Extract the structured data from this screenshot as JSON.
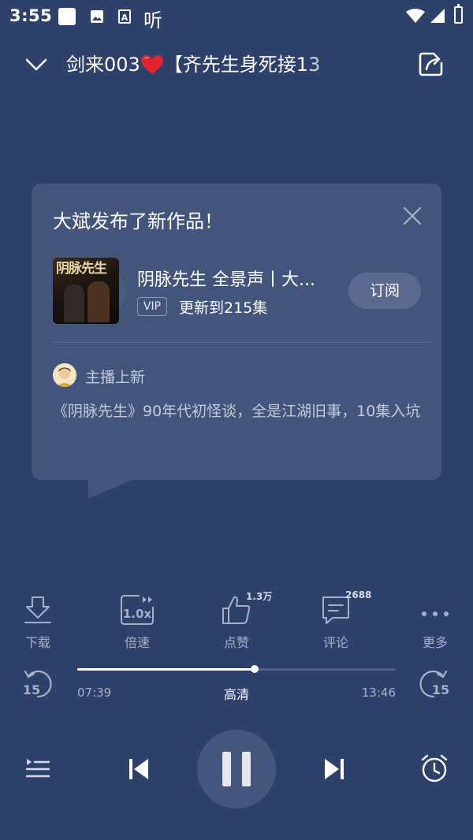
{
  "status_bar": {
    "time": "3:55",
    "listen_glyph": "听",
    "app_icon_letter": "A",
    "icons": [
      "app-square-icon",
      "image-icon",
      "a-badge-icon",
      "listen-icon",
      "wifi-icon",
      "signal-icon",
      "battery-icon"
    ]
  },
  "header": {
    "title_prefix": "剑来003",
    "title_suffix": "【齐先生身死接13",
    "icons": [
      "chevron-down-icon",
      "heart-icon",
      "share-icon"
    ]
  },
  "notification": {
    "title": "大斌发布了新作品！",
    "cover_text": "阴脉先生",
    "work_title": "阴脉先生 全景声丨大...",
    "vip_label": "VIP",
    "update_text": "更新到215集",
    "subscribe_label": "订阅",
    "anchor_label": "主播上新",
    "description": "《阴脉先生》90年代初怪谈，全是江湖旧事，10集入坑"
  },
  "actions": {
    "download_label": "下载",
    "speed_label": "倍速",
    "speed_value": "1.0x",
    "like_label": "点赞",
    "like_count": "1.3万",
    "comment_label": "评论",
    "comment_count": "2688",
    "more_label": "更多"
  },
  "player": {
    "rewind_seconds": "15",
    "forward_seconds": "15",
    "current_time": "07:39",
    "total_time": "13:46",
    "quality": "高清",
    "progress_fraction": 0.556,
    "state": "playing"
  },
  "colors": {
    "background": "#2e416b",
    "card": "#44557c",
    "muted_text": "#a7b0c8"
  }
}
